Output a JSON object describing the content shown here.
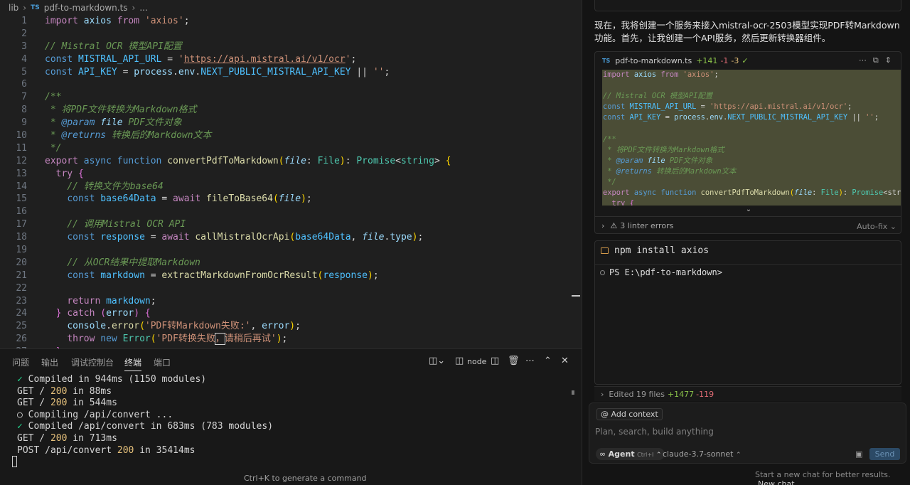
{
  "breadcrumb": {
    "folder": "lib",
    "file_badge": "TS",
    "file": "pdf-to-markdown.ts",
    "trail": "..."
  },
  "editor": {
    "lines": [
      {
        "n": "1",
        "tokens": [
          [
            "kwc",
            "import"
          ],
          [
            "pl",
            " "
          ],
          [
            "id",
            "axios"
          ],
          [
            "pl",
            " "
          ],
          [
            "kwc",
            "from"
          ],
          [
            "pl",
            " "
          ],
          [
            "str",
            "'axios'"
          ],
          [
            "pl",
            ";"
          ]
        ]
      },
      {
        "n": "2",
        "tokens": []
      },
      {
        "n": "3",
        "tokens": [
          [
            "cm",
            "// Mistral OCR 模型API配置"
          ]
        ]
      },
      {
        "n": "4",
        "tokens": [
          [
            "kw",
            "const"
          ],
          [
            "pl",
            " "
          ],
          [
            "cst",
            "MISTRAL_API_URL"
          ],
          [
            "pl",
            " = "
          ],
          [
            "str",
            "'"
          ],
          [
            "str ul",
            "https://api.mistral.ai/v1/ocr"
          ],
          [
            "str",
            "'"
          ],
          [
            "pl",
            ";"
          ]
        ]
      },
      {
        "n": "5",
        "tokens": [
          [
            "kw",
            "const"
          ],
          [
            "pl",
            " "
          ],
          [
            "cst",
            "API_KEY"
          ],
          [
            "pl",
            " = "
          ],
          [
            "id",
            "process"
          ],
          [
            "pl",
            "."
          ],
          [
            "id",
            "env"
          ],
          [
            "pl",
            "."
          ],
          [
            "cst",
            "NEXT_PUBLIC_MISTRAL_API_KEY"
          ],
          [
            "pl",
            " || "
          ],
          [
            "str",
            "''"
          ],
          [
            "pl",
            ";"
          ]
        ]
      },
      {
        "n": "6",
        "tokens": []
      },
      {
        "n": "7",
        "tokens": [
          [
            "cm",
            "/**"
          ]
        ]
      },
      {
        "n": "8",
        "tokens": [
          [
            "cm",
            " * 将PDF文件转换为Markdown格式"
          ]
        ]
      },
      {
        "n": "9",
        "tokens": [
          [
            "cm",
            " * "
          ],
          [
            "tag",
            "@param"
          ],
          [
            "cm",
            " "
          ],
          [
            "par",
            "file"
          ],
          [
            "cm",
            " PDF文件对象"
          ]
        ]
      },
      {
        "n": "10",
        "tokens": [
          [
            "cm",
            " * "
          ],
          [
            "tag",
            "@returns"
          ],
          [
            "cm",
            " 转换后的Markdown文本"
          ]
        ]
      },
      {
        "n": "11",
        "tokens": [
          [
            "cm",
            " */"
          ]
        ]
      },
      {
        "n": "12",
        "tokens": [
          [
            "kwc",
            "export"
          ],
          [
            "pl",
            " "
          ],
          [
            "kw",
            "async"
          ],
          [
            "pl",
            " "
          ],
          [
            "kw",
            "function"
          ],
          [
            "pl",
            " "
          ],
          [
            "fn",
            "convertPdfToMarkdown"
          ],
          [
            "br",
            "("
          ],
          [
            "par",
            "file"
          ],
          [
            "pl",
            ": "
          ],
          [
            "ty",
            "File"
          ],
          [
            "br",
            ")"
          ],
          [
            "pl",
            ": "
          ],
          [
            "ty",
            "Promise"
          ],
          [
            "pl",
            "<"
          ],
          [
            "ty",
            "string"
          ],
          [
            "pl",
            "> "
          ],
          [
            "br",
            "{"
          ]
        ]
      },
      {
        "n": "13",
        "tokens": [
          [
            "pl",
            "  "
          ],
          [
            "kwc",
            "try"
          ],
          [
            "pl",
            " "
          ],
          [
            "brp",
            "{"
          ]
        ]
      },
      {
        "n": "14",
        "tokens": [
          [
            "pl",
            "    "
          ],
          [
            "cm",
            "// 转换文件为base64"
          ]
        ]
      },
      {
        "n": "15",
        "tokens": [
          [
            "pl",
            "    "
          ],
          [
            "kw",
            "const"
          ],
          [
            "pl",
            " "
          ],
          [
            "cst",
            "base64Data"
          ],
          [
            "pl",
            " = "
          ],
          [
            "kwc",
            "await"
          ],
          [
            "pl",
            " "
          ],
          [
            "fn",
            "fileToBase64"
          ],
          [
            "br",
            "("
          ],
          [
            "par",
            "file"
          ],
          [
            "br",
            ")"
          ],
          [
            "pl",
            ";"
          ]
        ]
      },
      {
        "n": "16",
        "tokens": []
      },
      {
        "n": "17",
        "tokens": [
          [
            "pl",
            "    "
          ],
          [
            "cm",
            "// 调用Mistral OCR API"
          ]
        ]
      },
      {
        "n": "18",
        "tokens": [
          [
            "pl",
            "    "
          ],
          [
            "kw",
            "const"
          ],
          [
            "pl",
            " "
          ],
          [
            "cst",
            "response"
          ],
          [
            "pl",
            " = "
          ],
          [
            "kwc",
            "await"
          ],
          [
            "pl",
            " "
          ],
          [
            "fn",
            "callMistralOcrApi"
          ],
          [
            "br",
            "("
          ],
          [
            "cst",
            "base64Data"
          ],
          [
            "pl",
            ", "
          ],
          [
            "par",
            "file"
          ],
          [
            "pl",
            "."
          ],
          [
            "id",
            "type"
          ],
          [
            "br",
            ")"
          ],
          [
            "pl",
            ";"
          ]
        ]
      },
      {
        "n": "19",
        "tokens": []
      },
      {
        "n": "20",
        "tokens": [
          [
            "pl",
            "    "
          ],
          [
            "cm",
            "// 从OCR结果中提取Markdown"
          ]
        ]
      },
      {
        "n": "21",
        "tokens": [
          [
            "pl",
            "    "
          ],
          [
            "kw",
            "const"
          ],
          [
            "pl",
            " "
          ],
          [
            "cst",
            "markdown"
          ],
          [
            "pl",
            " = "
          ],
          [
            "fn",
            "extractMarkdownFromOcrResult"
          ],
          [
            "br",
            "("
          ],
          [
            "cst",
            "response"
          ],
          [
            "br",
            ")"
          ],
          [
            "pl",
            ";"
          ]
        ]
      },
      {
        "n": "22",
        "tokens": []
      },
      {
        "n": "23",
        "tokens": [
          [
            "pl",
            "    "
          ],
          [
            "kwc",
            "return"
          ],
          [
            "pl",
            " "
          ],
          [
            "cst",
            "markdown"
          ],
          [
            "pl",
            ";"
          ]
        ]
      },
      {
        "n": "24",
        "tokens": [
          [
            "pl",
            "  "
          ],
          [
            "brp",
            "}"
          ],
          [
            "pl",
            " "
          ],
          [
            "kwc",
            "catch"
          ],
          [
            "pl",
            " "
          ],
          [
            "brp",
            "("
          ],
          [
            "id",
            "error"
          ],
          [
            "brp",
            ")"
          ],
          [
            "pl",
            " "
          ],
          [
            "brp",
            "{"
          ]
        ]
      },
      {
        "n": "25",
        "tokens": [
          [
            "pl",
            "    "
          ],
          [
            "id",
            "console"
          ],
          [
            "pl",
            "."
          ],
          [
            "fn",
            "error"
          ],
          [
            "br",
            "("
          ],
          [
            "str",
            "'PDF转Markdown失败:'"
          ],
          [
            "pl",
            ", "
          ],
          [
            "id",
            "error"
          ],
          [
            "br",
            ")"
          ],
          [
            "pl",
            ";"
          ]
        ]
      },
      {
        "n": "26",
        "tokens": [
          [
            "pl",
            "    "
          ],
          [
            "kwc",
            "throw"
          ],
          [
            "pl",
            " "
          ],
          [
            "kw",
            "new"
          ],
          [
            "pl",
            " "
          ],
          [
            "ty",
            "Error"
          ],
          [
            "br",
            "("
          ],
          [
            "str",
            "'PDF转换失败"
          ],
          [
            "str cursor-box",
            "，"
          ],
          [
            "str",
            "请稍后再试'"
          ],
          [
            "br",
            ")"
          ],
          [
            "pl",
            ";"
          ]
        ]
      },
      {
        "n": "27",
        "tokens": [
          [
            "pl",
            "  "
          ],
          [
            "brp",
            "}"
          ]
        ]
      }
    ]
  },
  "panel": {
    "tabs": [
      "问题",
      "输出",
      "调试控制台",
      "终端",
      "端口"
    ],
    "active_tab": "终端",
    "terminal_profile": "node",
    "terminal_lines": [
      [
        [
          "ok",
          "✓"
        ],
        [
          "pl",
          " Compiled in 944ms (1150 modules)"
        ]
      ],
      [
        [
          "pl",
          "GET / "
        ],
        [
          "num",
          "200"
        ],
        [
          "pl",
          " in 88ms"
        ]
      ],
      [
        [
          "pl",
          "GET / "
        ],
        [
          "num",
          "200"
        ],
        [
          "pl",
          " in 544ms"
        ]
      ],
      [
        [
          "pl",
          "○ Compiling /api/convert ..."
        ]
      ],
      [
        [
          "ok",
          "✓"
        ],
        [
          "pl",
          " Compiled /api/convert in 683ms (783 modules)"
        ]
      ],
      [
        [
          "pl",
          "GET / "
        ],
        [
          "num",
          "200"
        ],
        [
          "pl",
          " in 713ms"
        ]
      ],
      [
        [
          "pl",
          "POST /api/convert "
        ],
        [
          "num",
          "200"
        ],
        [
          "pl",
          " in 35414ms"
        ]
      ]
    ],
    "cmd_hint": "Ctrl+K to generate a command"
  },
  "chat": {
    "message": "现在，我将创建一个服务来接入mistral-ocr-2503模型实现PDF转Markdown功能。首先，让我创建一个API服务，然后更新转换器组件。",
    "code_card": {
      "badge": "TS",
      "file": "pdf-to-markdown.ts",
      "added": "+141",
      "removed": "-1",
      "changed": "-3",
      "check": "✓",
      "lint": "3 linter errors",
      "autofix": "Auto-fix",
      "lines": [
        [
          [
            "kwc",
            "import"
          ],
          [
            "pl",
            " "
          ],
          [
            "id",
            "axios"
          ],
          [
            "pl",
            " "
          ],
          [
            "kwc",
            "from"
          ],
          [
            "pl",
            " "
          ],
          [
            "str",
            "'axios'"
          ],
          [
            "pl",
            ";"
          ]
        ],
        [],
        [
          [
            "cm",
            "// Mistral OCR 模型API配置"
          ]
        ],
        [
          [
            "kw",
            "const"
          ],
          [
            "pl",
            " "
          ],
          [
            "cst",
            "MISTRAL_API_URL"
          ],
          [
            "pl",
            " = "
          ],
          [
            "str",
            "'https://api.mistral.ai/v1/ocr'"
          ],
          [
            "pl",
            ";"
          ]
        ],
        [
          [
            "kw",
            "const"
          ],
          [
            "pl",
            " "
          ],
          [
            "cst",
            "API_KEY"
          ],
          [
            "pl",
            " = "
          ],
          [
            "id",
            "process"
          ],
          [
            "pl",
            "."
          ],
          [
            "id",
            "env"
          ],
          [
            "pl",
            "."
          ],
          [
            "cst",
            "NEXT_PUBLIC_MISTRAL_API_KEY"
          ],
          [
            "pl",
            " || "
          ],
          [
            "str",
            "''"
          ],
          [
            "pl",
            ";"
          ]
        ],
        [],
        [
          [
            "cm",
            "/**"
          ]
        ],
        [
          [
            "cm",
            " * 将PDF文件转换为Markdown格式"
          ]
        ],
        [
          [
            "cm",
            " * "
          ],
          [
            "tag",
            "@param"
          ],
          [
            "cm",
            " "
          ],
          [
            "par",
            "file"
          ],
          [
            "cm",
            " PDF文件对象"
          ]
        ],
        [
          [
            "cm",
            " * "
          ],
          [
            "tag",
            "@returns"
          ],
          [
            "cm",
            " 转换后的Markdown文本"
          ]
        ],
        [
          [
            "cm",
            " */"
          ]
        ],
        [
          [
            "kwc",
            "export"
          ],
          [
            "pl",
            " "
          ],
          [
            "kw",
            "async"
          ],
          [
            "pl",
            " "
          ],
          [
            "kw",
            "function"
          ],
          [
            "pl",
            " "
          ],
          [
            "fn",
            "convertPdfToMarkdown"
          ],
          [
            "br",
            "("
          ],
          [
            "par",
            "file"
          ],
          [
            "pl",
            ": "
          ],
          [
            "ty",
            "File"
          ],
          [
            "br",
            ")"
          ],
          [
            "pl",
            ": "
          ],
          [
            "ty",
            "Promise"
          ],
          [
            "pl",
            "<stri"
          ]
        ],
        [
          [
            "pl",
            "  "
          ],
          [
            "kwc",
            "try"
          ],
          [
            "pl",
            " "
          ],
          [
            "brp",
            "{"
          ]
        ]
      ]
    },
    "terminal_card": {
      "command": "npm install axios",
      "prompt_line": "PS E:\\pdf-to-markdown>"
    },
    "edited_bar": {
      "text": "Edited 19 files",
      "added": "+1477",
      "removed": "-119"
    },
    "input": {
      "add_context": "Add context",
      "placeholder": "Plan, search, build anything",
      "agent_label": "Agent",
      "agent_shortcut": "Ctrl+I",
      "model": "claude-3.7-sonnet",
      "send": "Send"
    },
    "footer": {
      "hint": "Start a new chat for better results.",
      "new_chat": "New chat"
    }
  }
}
